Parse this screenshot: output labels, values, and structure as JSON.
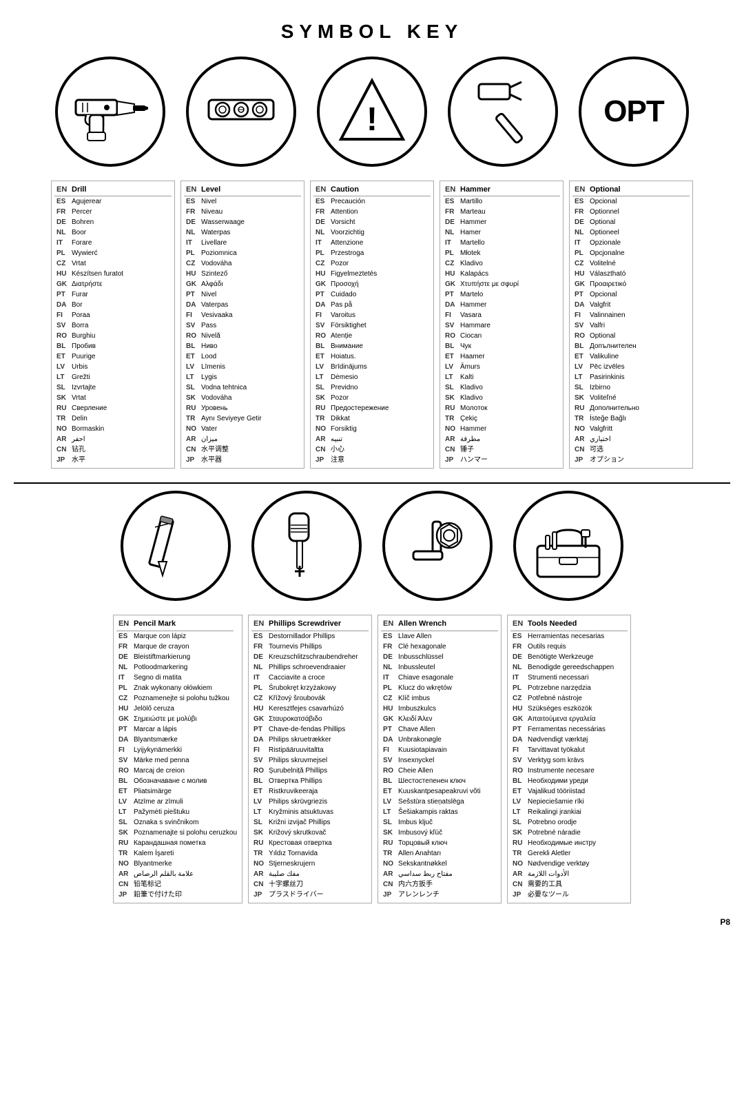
{
  "title": "SYMBOL KEY",
  "page": "P8",
  "icons_row1": [
    {
      "id": "drill",
      "type": "circle"
    },
    {
      "id": "level",
      "type": "circle"
    },
    {
      "id": "caution",
      "type": "triangle"
    },
    {
      "id": "hammer",
      "type": "circle"
    },
    {
      "id": "optional",
      "type": "opt"
    }
  ],
  "icons_row2": [
    {
      "id": "pencil",
      "type": "circle"
    },
    {
      "id": "phillips",
      "type": "circle"
    },
    {
      "id": "allen",
      "type": "circle"
    },
    {
      "id": "tools",
      "type": "circle"
    }
  ],
  "tables": {
    "drill": {
      "header": [
        "EN",
        "Drill"
      ],
      "rows": [
        [
          "ES",
          "Agujerear"
        ],
        [
          "FR",
          "Percer"
        ],
        [
          "DE",
          "Bohren"
        ],
        [
          "NL",
          "Boor"
        ],
        [
          "IT",
          "Forare"
        ],
        [
          "PL",
          "Wywierć"
        ],
        [
          "CZ",
          "Vrtat"
        ],
        [
          "HU",
          "Készítsen furatot"
        ],
        [
          "GK",
          "Διατρήστε"
        ],
        [
          "PT",
          "Furar"
        ],
        [
          "DA",
          "Bor"
        ],
        [
          "FI",
          "Poraa"
        ],
        [
          "SV",
          "Borra"
        ],
        [
          "RO",
          "Burghiu"
        ],
        [
          "BL",
          "Пробив"
        ],
        [
          "ET",
          "Puurige"
        ],
        [
          "LV",
          "Urbis"
        ],
        [
          "LT",
          "Grežti"
        ],
        [
          "SL",
          "Izvrtajte"
        ],
        [
          "SK",
          "Vrtat"
        ],
        [
          "RU",
          "Сверление"
        ],
        [
          "TR",
          "Delin"
        ],
        [
          "NO",
          "Bormaskin"
        ],
        [
          "AR",
          "احفر"
        ],
        [
          "CN",
          "钻孔"
        ],
        [
          "JP",
          "水平"
        ]
      ]
    },
    "level": {
      "header": [
        "EN",
        "Level"
      ],
      "rows": [
        [
          "ES",
          "Nivel"
        ],
        [
          "FR",
          "Niveau"
        ],
        [
          "DE",
          "Wasserwaage"
        ],
        [
          "NL",
          "Waterpas"
        ],
        [
          "IT",
          "Livellare"
        ],
        [
          "PL",
          "Poziomnica"
        ],
        [
          "CZ",
          "Vodováha"
        ],
        [
          "HU",
          "Szintező"
        ],
        [
          "GK",
          "Αλφάδι"
        ],
        [
          "PT",
          "Nivel"
        ],
        [
          "DA",
          "Vaterpas"
        ],
        [
          "FI",
          "Vesivaaka"
        ],
        [
          "SV",
          "Pass"
        ],
        [
          "RO",
          "Nivelă"
        ],
        [
          "BL",
          "Ниво"
        ],
        [
          "ET",
          "Lood"
        ],
        [
          "LV",
          "Līmenis"
        ],
        [
          "LT",
          "Lygis"
        ],
        [
          "SL",
          "Vodna tehtnica"
        ],
        [
          "SK",
          "Vodováha"
        ],
        [
          "RU",
          "Уровень"
        ],
        [
          "TR",
          "Aynı Seviyeye Getir"
        ],
        [
          "NO",
          "Vater"
        ],
        [
          "AR",
          "ميزان"
        ],
        [
          "CN",
          "水平调整"
        ],
        [
          "JP",
          "水平器"
        ]
      ]
    },
    "caution": {
      "header": [
        "EN",
        "Caution"
      ],
      "rows": [
        [
          "ES",
          "Precaución"
        ],
        [
          "FR",
          "Attention"
        ],
        [
          "DE",
          "Vorsicht"
        ],
        [
          "NL",
          "Voorzichtig"
        ],
        [
          "IT",
          "Attenzione"
        ],
        [
          "PL",
          "Przestroga"
        ],
        [
          "CZ",
          "Pozor"
        ],
        [
          "HU",
          "Figyelmeztetés"
        ],
        [
          "GK",
          "Προσοχή"
        ],
        [
          "PT",
          "Cuidado"
        ],
        [
          "DA",
          "Pas på"
        ],
        [
          "FI",
          "Varoitus"
        ],
        [
          "SV",
          "Försiktighet"
        ],
        [
          "RO",
          "Atenție"
        ],
        [
          "BL",
          "Внимание"
        ],
        [
          "ET",
          "Hoiatus."
        ],
        [
          "LV",
          "Brīdinājums"
        ],
        [
          "LT",
          "Dėmesio"
        ],
        [
          "SL",
          "Previdno"
        ],
        [
          "SK",
          "Pozor"
        ],
        [
          "RU",
          "Предостережение"
        ],
        [
          "TR",
          "Dikkat"
        ],
        [
          "NO",
          "Forsiktig"
        ],
        [
          "AR",
          "تنبيه"
        ],
        [
          "CN",
          "小心"
        ],
        [
          "JP",
          "注意"
        ]
      ]
    },
    "hammer": {
      "header": [
        "EN",
        "Hammer"
      ],
      "rows": [
        [
          "ES",
          "Martillo"
        ],
        [
          "FR",
          "Marteau"
        ],
        [
          "DE",
          "Hammer"
        ],
        [
          "NL",
          "Hamer"
        ],
        [
          "IT",
          "Martello"
        ],
        [
          "PL",
          "Młotek"
        ],
        [
          "CZ",
          "Kladivo"
        ],
        [
          "HU",
          "Kalapács"
        ],
        [
          "GK",
          "Χτυπήστε με σφυρί"
        ],
        [
          "PT",
          "Martelo"
        ],
        [
          "DA",
          "Hammer"
        ],
        [
          "FI",
          "Vasara"
        ],
        [
          "SV",
          "Hammare"
        ],
        [
          "RO",
          "Ciocan"
        ],
        [
          "BL",
          "Чук"
        ],
        [
          "ET",
          "Haamer"
        ],
        [
          "LV",
          "Āmurs"
        ],
        [
          "LT",
          "Kalti"
        ],
        [
          "SL",
          "Kladivo"
        ],
        [
          "SK",
          "Kladivo"
        ],
        [
          "RU",
          "Молоток"
        ],
        [
          "TR",
          "Çekiç"
        ],
        [
          "NO",
          "Hammer"
        ],
        [
          "AR",
          "مطرقة"
        ],
        [
          "CN",
          "锤子"
        ],
        [
          "JP",
          "ハンマー"
        ]
      ]
    },
    "optional": {
      "header": [
        "EN",
        "Optional"
      ],
      "rows": [
        [
          "ES",
          "Opcional"
        ],
        [
          "FR",
          "Optionnel"
        ],
        [
          "DE",
          "Optional"
        ],
        [
          "NL",
          "Optioneel"
        ],
        [
          "IT",
          "Opzionale"
        ],
        [
          "PL",
          "Opcjonalne"
        ],
        [
          "CZ",
          "Volitelné"
        ],
        [
          "HU",
          "Választható"
        ],
        [
          "GK",
          "Προαιρετικό"
        ],
        [
          "PT",
          "Opcional"
        ],
        [
          "DA",
          "Valgfrit"
        ],
        [
          "FI",
          "Valinnainen"
        ],
        [
          "SV",
          "Valfri"
        ],
        [
          "RO",
          "Optional"
        ],
        [
          "BL",
          "Допълнителен"
        ],
        [
          "ET",
          "Valikuline"
        ],
        [
          "LV",
          "Pēc izvēles"
        ],
        [
          "LT",
          "Pasirinkinis"
        ],
        [
          "SL",
          "Izbirno"
        ],
        [
          "SK",
          "Voliteľné"
        ],
        [
          "RU",
          "Дополнительно"
        ],
        [
          "TR",
          "İsteğe Bağlı"
        ],
        [
          "NO",
          "Valgfritt"
        ],
        [
          "AR",
          "اختياري"
        ],
        [
          "CN",
          "可选"
        ],
        [
          "JP",
          "オプション"
        ]
      ]
    },
    "pencil": {
      "header": [
        "EN",
        "Pencil Mark"
      ],
      "rows": [
        [
          "ES",
          "Marque con lápiz"
        ],
        [
          "FR",
          "Marque de crayon"
        ],
        [
          "DE",
          "Bleistiftmarkierung"
        ],
        [
          "NL",
          "Potloodmarkering"
        ],
        [
          "IT",
          "Segno di matita"
        ],
        [
          "PL",
          "Znak wykonany ołówkiem"
        ],
        [
          "CZ",
          "Poznamenejte si polohu tužkou"
        ],
        [
          "HU",
          "Jelölő ceruza"
        ],
        [
          "GK",
          "Σημειώστε με μολύβι"
        ],
        [
          "PT",
          "Marcar a lápis"
        ],
        [
          "DA",
          "Blyantsmærke"
        ],
        [
          "FI",
          "Lyijykynämerkki"
        ],
        [
          "SV",
          "Märke med penna"
        ],
        [
          "RO",
          "Marcaj de creion"
        ],
        [
          "BL",
          "Обозначаване с молив"
        ],
        [
          "ET",
          "Pliatsimärge"
        ],
        [
          "LV",
          "Atzīme ar zīmuli"
        ],
        [
          "LT",
          "Pažymėti pieštuku"
        ],
        [
          "SL",
          "Oznaka s svinčnikom"
        ],
        [
          "SK",
          "Poznamenajte si polohu ceruzkou"
        ],
        [
          "RU",
          "Карандашная пометка"
        ],
        [
          "TR",
          "Kalem İşareti"
        ],
        [
          "NO",
          "Blyantmerke"
        ],
        [
          "AR",
          "علامة بالقلم الرصاص"
        ],
        [
          "CN",
          "铅笔标记"
        ],
        [
          "JP",
          "鉛筆で付けた印"
        ]
      ]
    },
    "phillips": {
      "header": [
        "EN",
        "Phillips Screwdriver"
      ],
      "rows": [
        [
          "ES",
          "Destornillador Phillips"
        ],
        [
          "FR",
          "Tournevis Phillips"
        ],
        [
          "DE",
          "Kreuzschlitzschraubendreher"
        ],
        [
          "NL",
          "Phillips schroevendraaier"
        ],
        [
          "IT",
          "Cacciavite a croce"
        ],
        [
          "PL",
          "Śrubokręt krzyżakowy"
        ],
        [
          "CZ",
          "Křížový šroubovák"
        ],
        [
          "HU",
          "Keresztfejes csavarhúzó"
        ],
        [
          "GK",
          "Σταυροκατσάβιδο"
        ],
        [
          "PT",
          "Chave-de-fendas Phillips"
        ],
        [
          "DA",
          "Philips skruetrækker"
        ],
        [
          "FI",
          "Ristipääruuvitaltta"
        ],
        [
          "SV",
          "Philips skruvmejsel"
        ],
        [
          "RO",
          "Șurubelniță Phillips"
        ],
        [
          "BL",
          "Отвертка Phillips"
        ],
        [
          "ET",
          "Ristkruvikeeraja"
        ],
        [
          "LV",
          "Philips skrūvgriezis"
        ],
        [
          "LT",
          "Kryžminis atsuktuvas"
        ],
        [
          "SL",
          "Križni izvijač Phillips"
        ],
        [
          "SK",
          "Križový skrutkovač"
        ],
        [
          "RU",
          "Крестовая отвертка"
        ],
        [
          "TR",
          "Yıldız Tornavida"
        ],
        [
          "NO",
          "Stjerneskrujern"
        ],
        [
          "AR",
          "مفك صليبة"
        ],
        [
          "CN",
          "十字螺丝刀"
        ],
        [
          "JP",
          "プラスドライバー"
        ]
      ]
    },
    "allen": {
      "header": [
        "EN",
        "Allen Wrench"
      ],
      "rows": [
        [
          "ES",
          "Llave Allen"
        ],
        [
          "FR",
          "Clé hexagonale"
        ],
        [
          "DE",
          "Inbusschlüssel"
        ],
        [
          "NL",
          "Inbussleutel"
        ],
        [
          "IT",
          "Chiave esagonale"
        ],
        [
          "PL",
          "Klucz do wkrętów"
        ],
        [
          "CZ",
          "Klíč imbus"
        ],
        [
          "HU",
          "Imbuszkulcs"
        ],
        [
          "GK",
          "Κλειδί Άλεν"
        ],
        [
          "PT",
          "Chave Allen"
        ],
        [
          "DA",
          "Unbrakonøgle"
        ],
        [
          "FI",
          "Kuusiotapiavain"
        ],
        [
          "SV",
          "Insexnyckel"
        ],
        [
          "RO",
          "Cheie Allen"
        ],
        [
          "BL",
          "Шестостепенен ключ"
        ],
        [
          "ET",
          "Kuuskantpesapeakruvi võti"
        ],
        [
          "LV",
          "Sešstūra stieņatslēga"
        ],
        [
          "LT",
          "Šešiakampis raktas"
        ],
        [
          "SL",
          "Imbus ključ"
        ],
        [
          "SK",
          "Imbusový kľúč"
        ],
        [
          "RU",
          "Торцовый ключ"
        ],
        [
          "TR",
          "Allen Anahtarı"
        ],
        [
          "NO",
          "Sekskantnøkkel"
        ],
        [
          "AR",
          "مفتاح ربط سداسي"
        ],
        [
          "CN",
          "内六方扳手"
        ],
        [
          "JP",
          "アレンレンチ"
        ]
      ]
    },
    "tools": {
      "header": [
        "EN",
        "Tools Needed"
      ],
      "rows": [
        [
          "ES",
          "Herramientas necesarias"
        ],
        [
          "FR",
          "Outils requis"
        ],
        [
          "DE",
          "Benötigte Werkzeuge"
        ],
        [
          "NL",
          "Benodigde gereedschappen"
        ],
        [
          "IT",
          "Strumenti necessari"
        ],
        [
          "PL",
          "Potrzebne narzędzia"
        ],
        [
          "CZ",
          "Potřebné nástroje"
        ],
        [
          "HU",
          "Szükséges eszközök"
        ],
        [
          "GK",
          "Απαιτούμενα εργαλεία"
        ],
        [
          "PT",
          "Ferramentas necessárias"
        ],
        [
          "DA",
          "Nødvendigt værktøj"
        ],
        [
          "FI",
          "Tarvittavat työkalut"
        ],
        [
          "SV",
          "Verktyg som krävs"
        ],
        [
          "RO",
          "Instrumente necesare"
        ],
        [
          "BL",
          "Необходими уреди"
        ],
        [
          "ET",
          "Vajalikud tööriistad"
        ],
        [
          "LV",
          "Nepieciešamie rīki"
        ],
        [
          "LT",
          "Reikalingi įrankiai"
        ],
        [
          "SL",
          "Potrebno orodje"
        ],
        [
          "SK",
          "Potrebné náradie"
        ],
        [
          "RU",
          "Необходимые инстру"
        ],
        [
          "TR",
          "Gerekli Aletler"
        ],
        [
          "NO",
          "Nødvendige verktøy"
        ],
        [
          "AR",
          "الأدوات اللازمة"
        ],
        [
          "CN",
          "需要的工具"
        ],
        [
          "JP",
          "必要なツール"
        ]
      ]
    }
  }
}
